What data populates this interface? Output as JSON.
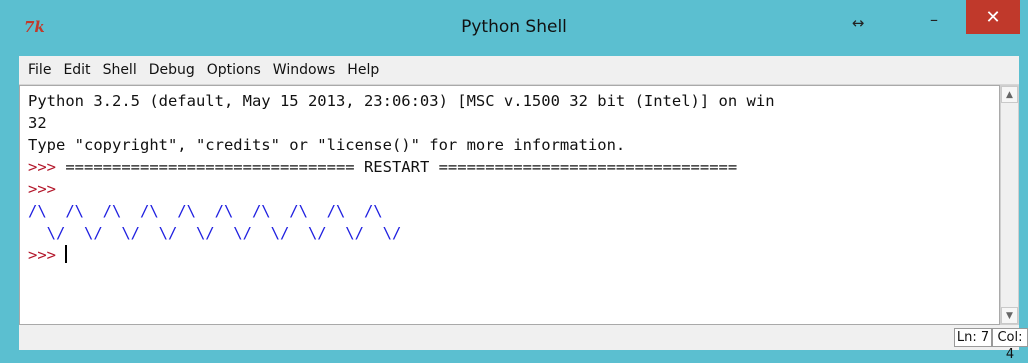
{
  "window": {
    "title": "Python Shell",
    "app_icon_text": "7k",
    "resize_icon": "↔",
    "min_icon": "–",
    "max_icon": "☐",
    "close_icon": "✕"
  },
  "menu": {
    "items": [
      {
        "label": "File"
      },
      {
        "label": "Edit"
      },
      {
        "label": "Shell"
      },
      {
        "label": "Debug"
      },
      {
        "label": "Options"
      },
      {
        "label": "Windows"
      },
      {
        "label": "Help"
      }
    ]
  },
  "shell": {
    "lines": [
      {
        "text": "Python 3.2.5 (default, May 15 2013, 23:06:03) [MSC v.1500 32 bit (Intel)] on win",
        "prompt": ""
      },
      {
        "text": "32",
        "prompt": ""
      },
      {
        "text": "Type \"copyright\", \"credits\" or \"license()\" for more information.",
        "prompt": ""
      },
      {
        "text": " =============================== RESTART ================================",
        "prompt": ">>>"
      },
      {
        "text": "",
        "prompt": ">>>"
      },
      {
        "text": "/\\  /\\  /\\  /\\  /\\  /\\  /\\  /\\  /\\  /\\",
        "prompt": ""
      },
      {
        "text": "  \\/  \\/  \\/  \\/  \\/  \\/  \\/  \\/  \\/  \\/",
        "prompt": ""
      },
      {
        "text": " ",
        "prompt": ">>>"
      }
    ]
  },
  "status": {
    "line": "Ln: 7",
    "col": "Col: 4"
  },
  "colors": {
    "prompt": "#b3172b",
    "output_blue": "#2020e0",
    "title_bar": "#5bbfd0",
    "close_button": "#c0392b"
  }
}
